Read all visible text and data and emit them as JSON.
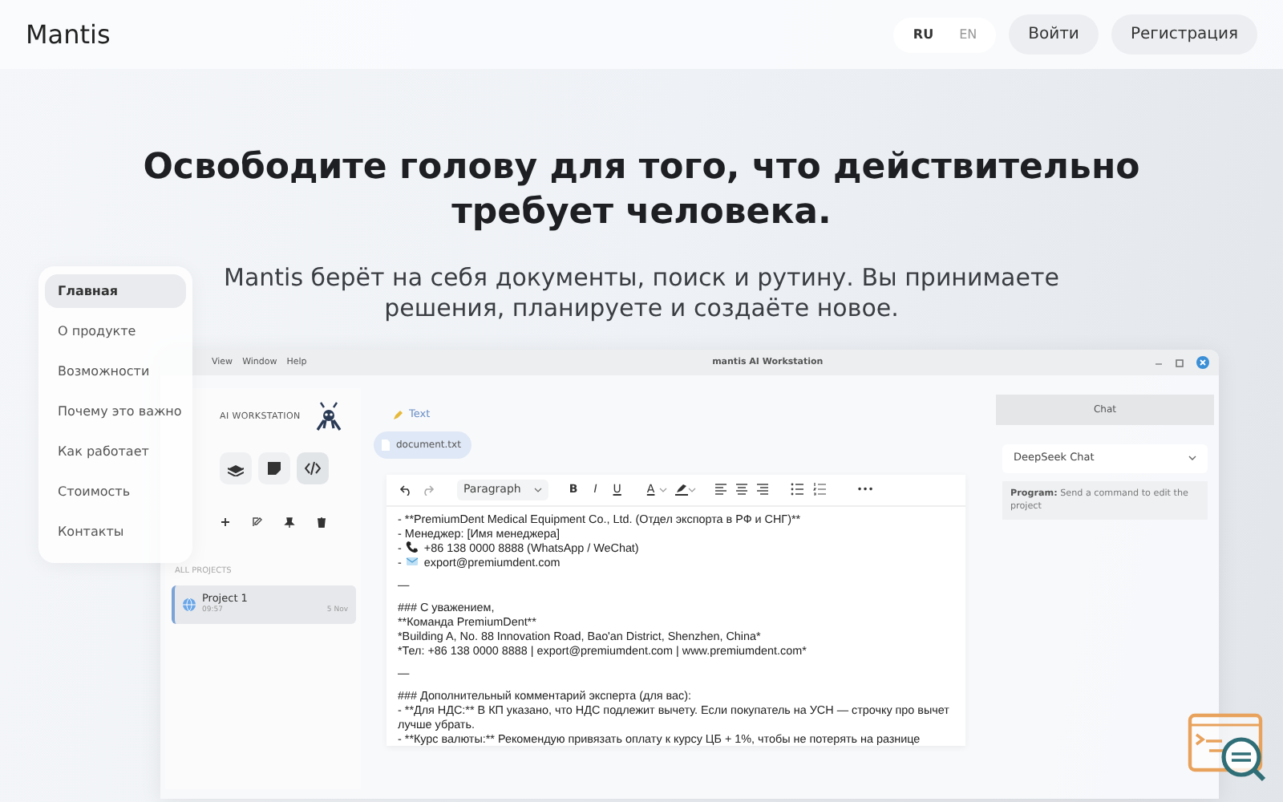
{
  "header": {
    "logo": "Mantis",
    "languages": [
      {
        "label": "RU",
        "selected": true
      },
      {
        "label": "EN",
        "selected": false
      }
    ],
    "buttons": [
      "Войти",
      "Регистрация"
    ]
  },
  "hero": {
    "title": "Освободите голову для того, что действительно требует человека.",
    "subtitle": "Mantis берёт на себя документы, поиск и рутину. Вы принимаете решения, планируете и создаёте новое."
  },
  "side_nav": [
    {
      "label": "Главная",
      "selected": true
    },
    {
      "label": "О продукте",
      "selected": false
    },
    {
      "label": "Возможности",
      "selected": false
    },
    {
      "label": "Почему это важно",
      "selected": false
    },
    {
      "label": "Как работает",
      "selected": false
    },
    {
      "label": "Стоимость",
      "selected": false
    },
    {
      "label": "Контакты",
      "selected": false
    }
  ],
  "app_window": {
    "menu": [
      "View",
      "Window",
      "Help"
    ],
    "title": "mantis AI Workstation",
    "sidebar": {
      "brand": "AI WORKSTATION",
      "tools": [
        {
          "kind": "layers",
          "selected": false
        },
        {
          "kind": "note",
          "selected": false
        },
        {
          "kind": "code",
          "selected": true
        }
      ],
      "projects_label": "ALL PROJECTS",
      "projects": [
        {
          "name": "Project 1",
          "time": "09:57",
          "date": "5 Nov",
          "selected": true
        }
      ]
    },
    "chip": "Text",
    "file": "document.txt",
    "toolbar": {
      "block_style": "Paragraph",
      "format_buttons": [
        "B",
        "I",
        "U"
      ],
      "color_button": "A",
      "more": "•••"
    },
    "document": [
      {
        "lines": [
          {
            "text": "- **PremiumDent Medical Equipment Co., Ltd. (Отдел экспорта в РФ и СНГ)**"
          },
          {
            "text": "- Менеджер: [Имя менеджера]"
          },
          {
            "prefix": "-",
            "text": "+86 138 0000 8888 (WhatsApp / WeChat)",
            "kind": "phone"
          },
          {
            "prefix": "-",
            "text": "export@premiumdent.com",
            "kind": "mail"
          }
        ]
      },
      {
        "lines": [
          {
            "text": "—"
          }
        ]
      },
      {
        "lines": [
          {
            "text": "### С уважением,"
          },
          {
            "text": "**Команда PremiumDent**"
          },
          {
            "text": "*Building A, No. 88 Innovation Road, Bao'an District, Shenzhen, China*"
          },
          {
            "text": "*Тел: +86 138 0000 8888 | export@premiumdent.com | www.premiumdent.com*"
          }
        ]
      },
      {
        "lines": [
          {
            "text": "—"
          }
        ]
      },
      {
        "lines": [
          {
            "text": "### Дополнительный комментарий эксперта (для вас):"
          },
          {
            "text": "- **Для НДС:** В КП указано, что НДС подлежит вычету. Если покупатель на УСН — строчку про вычет лучше убрать."
          },
          {
            "text": "- **Курс валюты:** Рекомендую привязать оплату к курсу ЦБ + 1%, чтобы не потерять на разнице"
          }
        ]
      }
    ],
    "chat": {
      "title": "Chat",
      "model": "DeepSeek Chat",
      "message": "**Program:** Send a command to edit the project"
    }
  }
}
